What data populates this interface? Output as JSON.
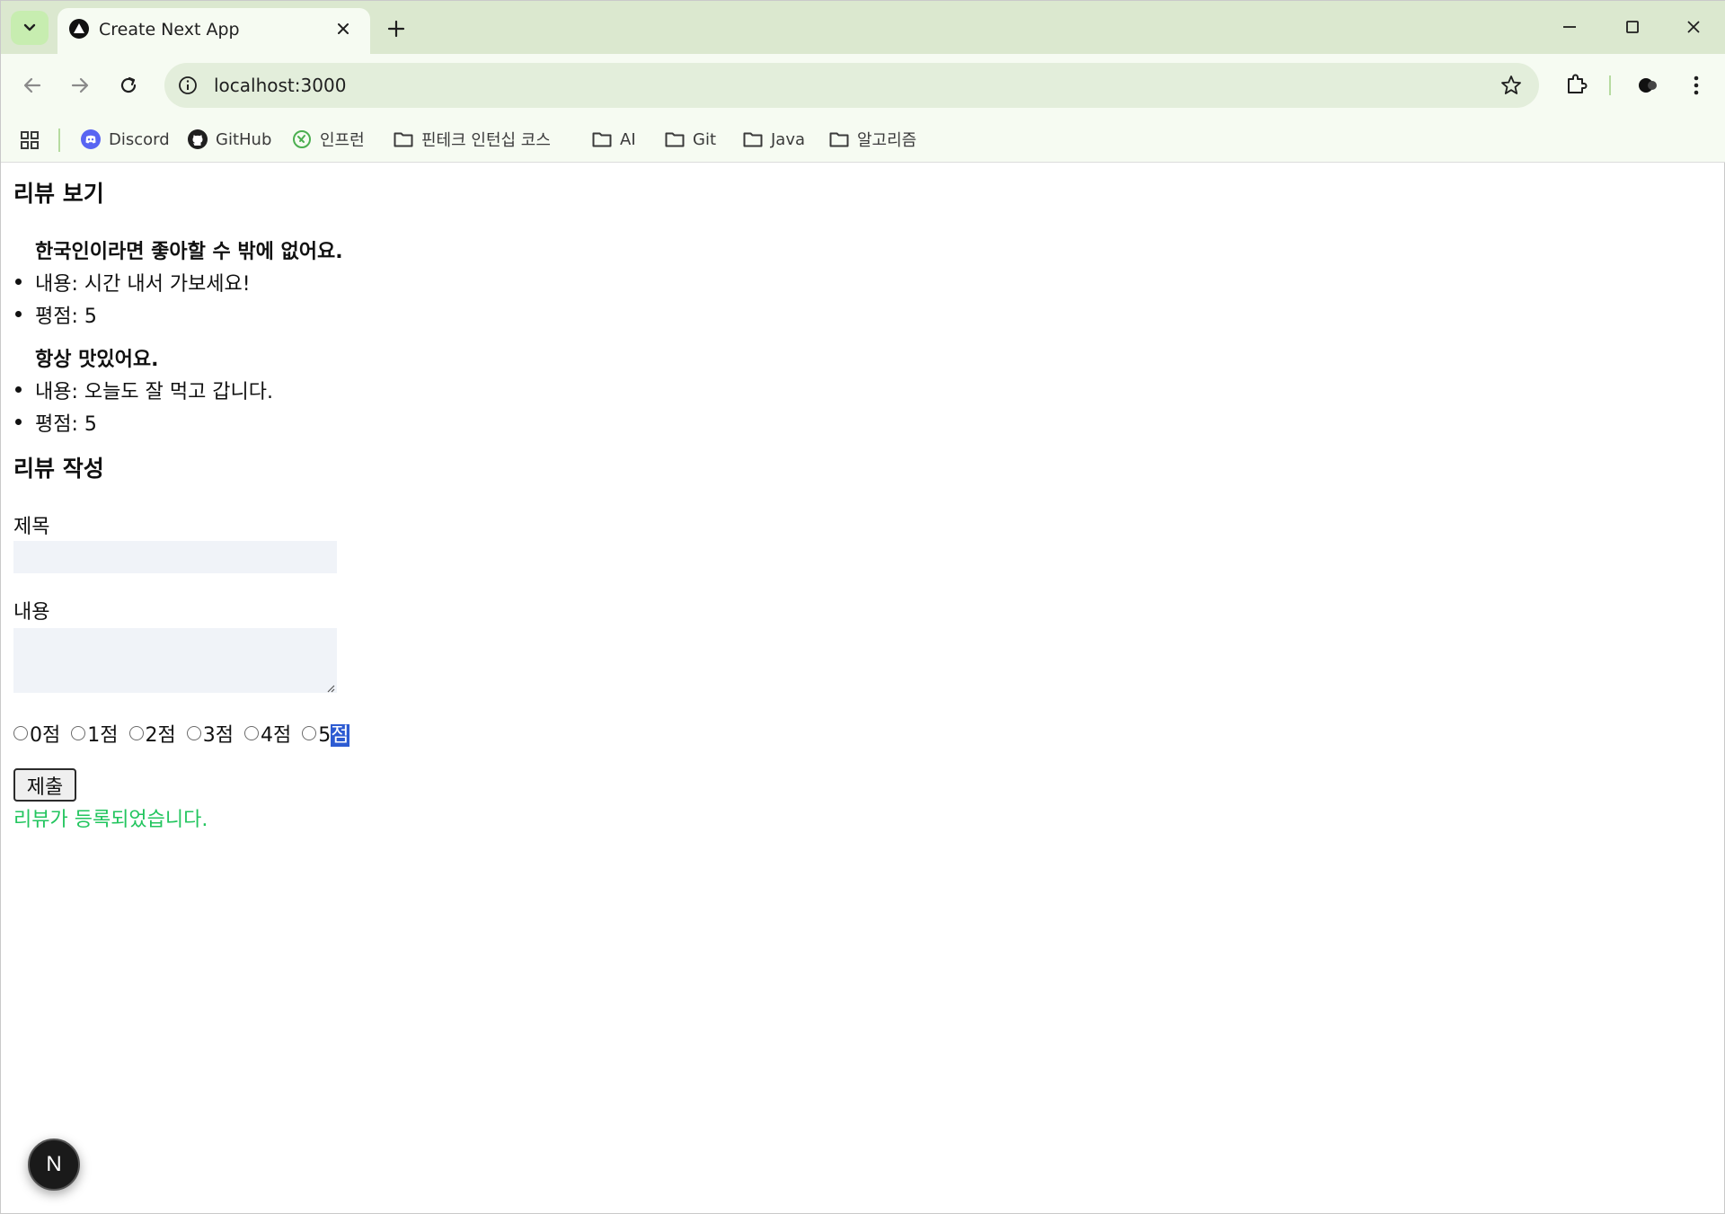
{
  "browser": {
    "tab_title": "Create Next App",
    "url": "localhost:3000",
    "bookmarks": [
      {
        "label": "Discord",
        "icon": "discord-icon"
      },
      {
        "label": "GitHub",
        "icon": "github-icon"
      },
      {
        "label": "인프런",
        "icon": "inflearn-icon"
      },
      {
        "label": "핀테크 인턴십 코스",
        "icon": "folder-icon"
      },
      {
        "label": "AI",
        "icon": "folder-icon"
      },
      {
        "label": "Git",
        "icon": "folder-icon"
      },
      {
        "label": "Java",
        "icon": "folder-icon"
      },
      {
        "label": "알고리즘",
        "icon": "folder-icon"
      }
    ]
  },
  "reviews_section": {
    "heading": "리뷰 보기",
    "reviews": [
      {
        "title": "한국인이라면 좋아할 수 밖에 없어요.",
        "content_line": "내용: 시간 내서 가보세요!",
        "rating_line": "평점: 5"
      },
      {
        "title": "항상 맛있어요.",
        "content_line": "내용: 오늘도 잘 먹고 갑니다.",
        "rating_line": "평점: 5"
      }
    ]
  },
  "form": {
    "heading": "리뷰 작성",
    "title_label": "제목",
    "title_value": "",
    "content_label": "내용",
    "content_value": "",
    "rating_options": [
      "0점",
      "1점",
      "2점",
      "3점",
      "4점",
      "5점"
    ],
    "selected_rating": null,
    "highlighted_text": "점",
    "submit_label": "제출",
    "success_message": "리뷰가 등록되었습니다."
  },
  "dev_badge": {
    "label": "N"
  },
  "colors": {
    "tab_strip": "#dbe8cf",
    "toolbar": "#f6fbf2",
    "success": "#22c55e",
    "selection": "#2d5bd2"
  }
}
